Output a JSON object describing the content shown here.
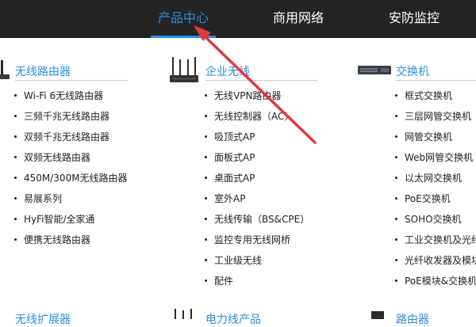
{
  "nav": {
    "items": [
      {
        "label": "产品中心",
        "active": true
      },
      {
        "label": "商用网络",
        "active": false
      },
      {
        "label": "安防监控",
        "active": false
      }
    ]
  },
  "columns": [
    {
      "title": "无线路由器",
      "items": [
        "Wi-Fi 6无线路由器",
        "三频千兆无线路由器",
        "双频千兆无线路由器",
        "双频无线路由器",
        "450M/300M无线路由器",
        "易展系列",
        "HyFi智能/全家通",
        "便携无线路由器"
      ]
    },
    {
      "title": "企业无线",
      "items": [
        "无线VPN路由器",
        "无线控制器（AC）",
        "吸顶式AP",
        "面板式AP",
        "桌面式AP",
        "室外AP",
        "无线传输（BS&CPE）",
        "监控专用无线网桥",
        "工业级无线",
        "配件"
      ]
    },
    {
      "title": "交换机",
      "items": [
        "框式交换机",
        "三层网管交换机",
        "网管交换机",
        "Web网管交换机",
        "以太网交换机",
        "PoE交换机",
        "SOHO交换机",
        "工业交换机及光纤",
        "光纤收发器及模块",
        "PoE模块&交换机"
      ]
    }
  ],
  "bottom_titles": [
    "无线扩展器",
    "电力线产品",
    "路由器"
  ],
  "colors": {
    "accent": "#2a8de0",
    "nav_bg": "#242424",
    "arrow": "#e03a3a"
  }
}
